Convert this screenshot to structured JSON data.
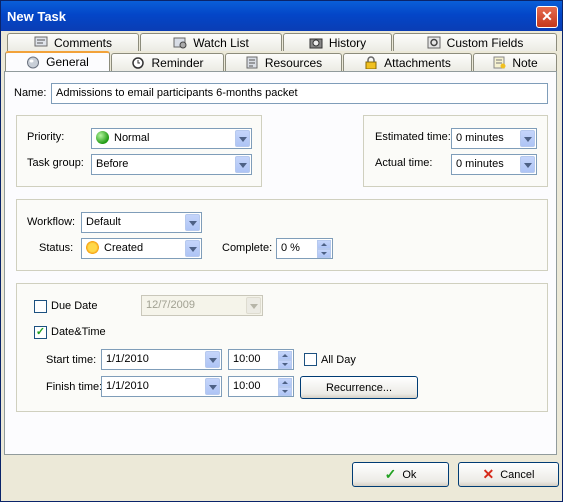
{
  "window": {
    "title": "New Task",
    "close_label": "✕"
  },
  "tabs_top": [
    {
      "label": "Comments",
      "icon": "comments-icon"
    },
    {
      "label": "Watch List",
      "icon": "watch-list-icon"
    },
    {
      "label": "History",
      "icon": "history-icon"
    },
    {
      "label": "Custom Fields",
      "icon": "custom-fields-icon"
    }
  ],
  "tabs_bottom": [
    {
      "label": "General",
      "icon": "general-icon",
      "active": true
    },
    {
      "label": "Reminder",
      "icon": "alarm-clock-icon"
    },
    {
      "label": "Resources",
      "icon": "resources-icon"
    },
    {
      "label": "Attachments",
      "icon": "lock-icon"
    },
    {
      "label": "Note",
      "icon": "note-icon"
    }
  ],
  "general": {
    "name_label": "Name:",
    "name_value": "Admissions to email participants 6-months packet",
    "priority_label": "Priority:",
    "priority_value": "Normal",
    "task_group_label": "Task group:",
    "task_group_value": "Before",
    "estimated_time_label": "Estimated time:",
    "estimated_time_value": "0 minutes",
    "actual_time_label": "Actual time:",
    "actual_time_value": "0 minutes",
    "workflow_label": "Workflow:",
    "workflow_value": "Default",
    "status_label": "Status:",
    "status_value": "Created",
    "complete_label": "Complete:",
    "complete_value": "0 %",
    "due_date_label": "Due Date",
    "due_date_checked": false,
    "due_date_value": "12/7/2009",
    "datetime_label": "Date&Time",
    "datetime_checked": true,
    "start_time_label": "Start time:",
    "start_date_value": "1/1/2010",
    "start_time_value": "10:00",
    "all_day_label": "All Day",
    "all_day_checked": false,
    "finish_time_label": "Finish time:",
    "finish_date_value": "1/1/2010",
    "finish_time_value": "10:00",
    "recurrence_label": "Recurrence..."
  },
  "footer": {
    "ok_label": "Ok",
    "cancel_label": "Cancel"
  },
  "colors": {
    "title_bar": "#0346c8",
    "dialog_bg": "#ece9d8",
    "ok_check": "#21a121",
    "cancel_x": "#d62a1a"
  }
}
